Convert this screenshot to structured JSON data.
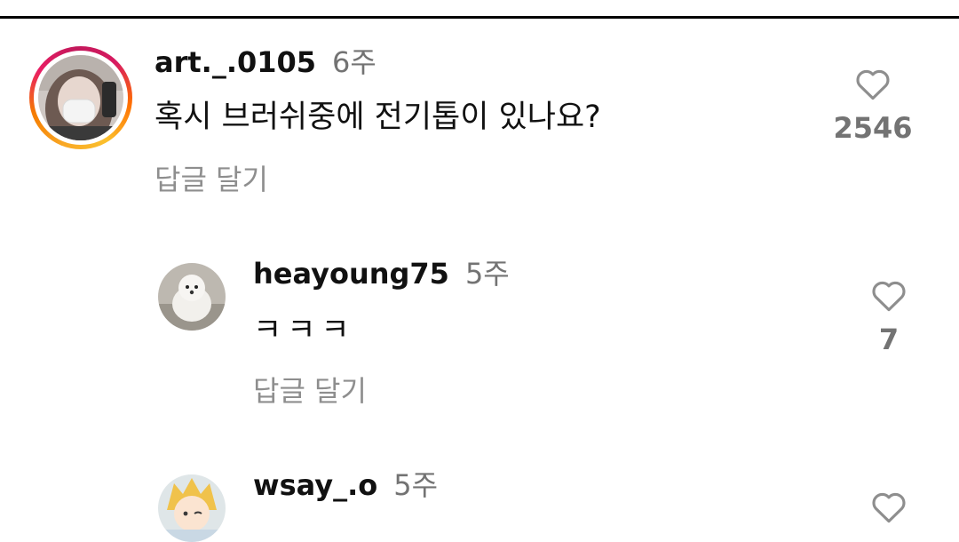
{
  "comments": [
    {
      "username": "art._.0105",
      "time": "6주",
      "text": "혹시 브러쉬중에 전기톱이 있나요?",
      "reply_label": "답글 달기",
      "likes": "2546",
      "avatar_icon": "profile-photo-masked-person",
      "has_story_ring": true
    },
    {
      "username": "heayoung75",
      "time": "5주",
      "text": "ㅋㅋㅋ",
      "reply_label": "답글 달기",
      "likes": "7",
      "avatar_icon": "profile-photo-white-dog"
    },
    {
      "username": "wsay_.o",
      "time": "5주",
      "avatar_icon": "profile-photo-anime-character"
    }
  ],
  "colors": {
    "text_primary": "#111111",
    "text_secondary": "#737373",
    "story_ring": [
      "#f9a825",
      "#e91e63"
    ]
  }
}
